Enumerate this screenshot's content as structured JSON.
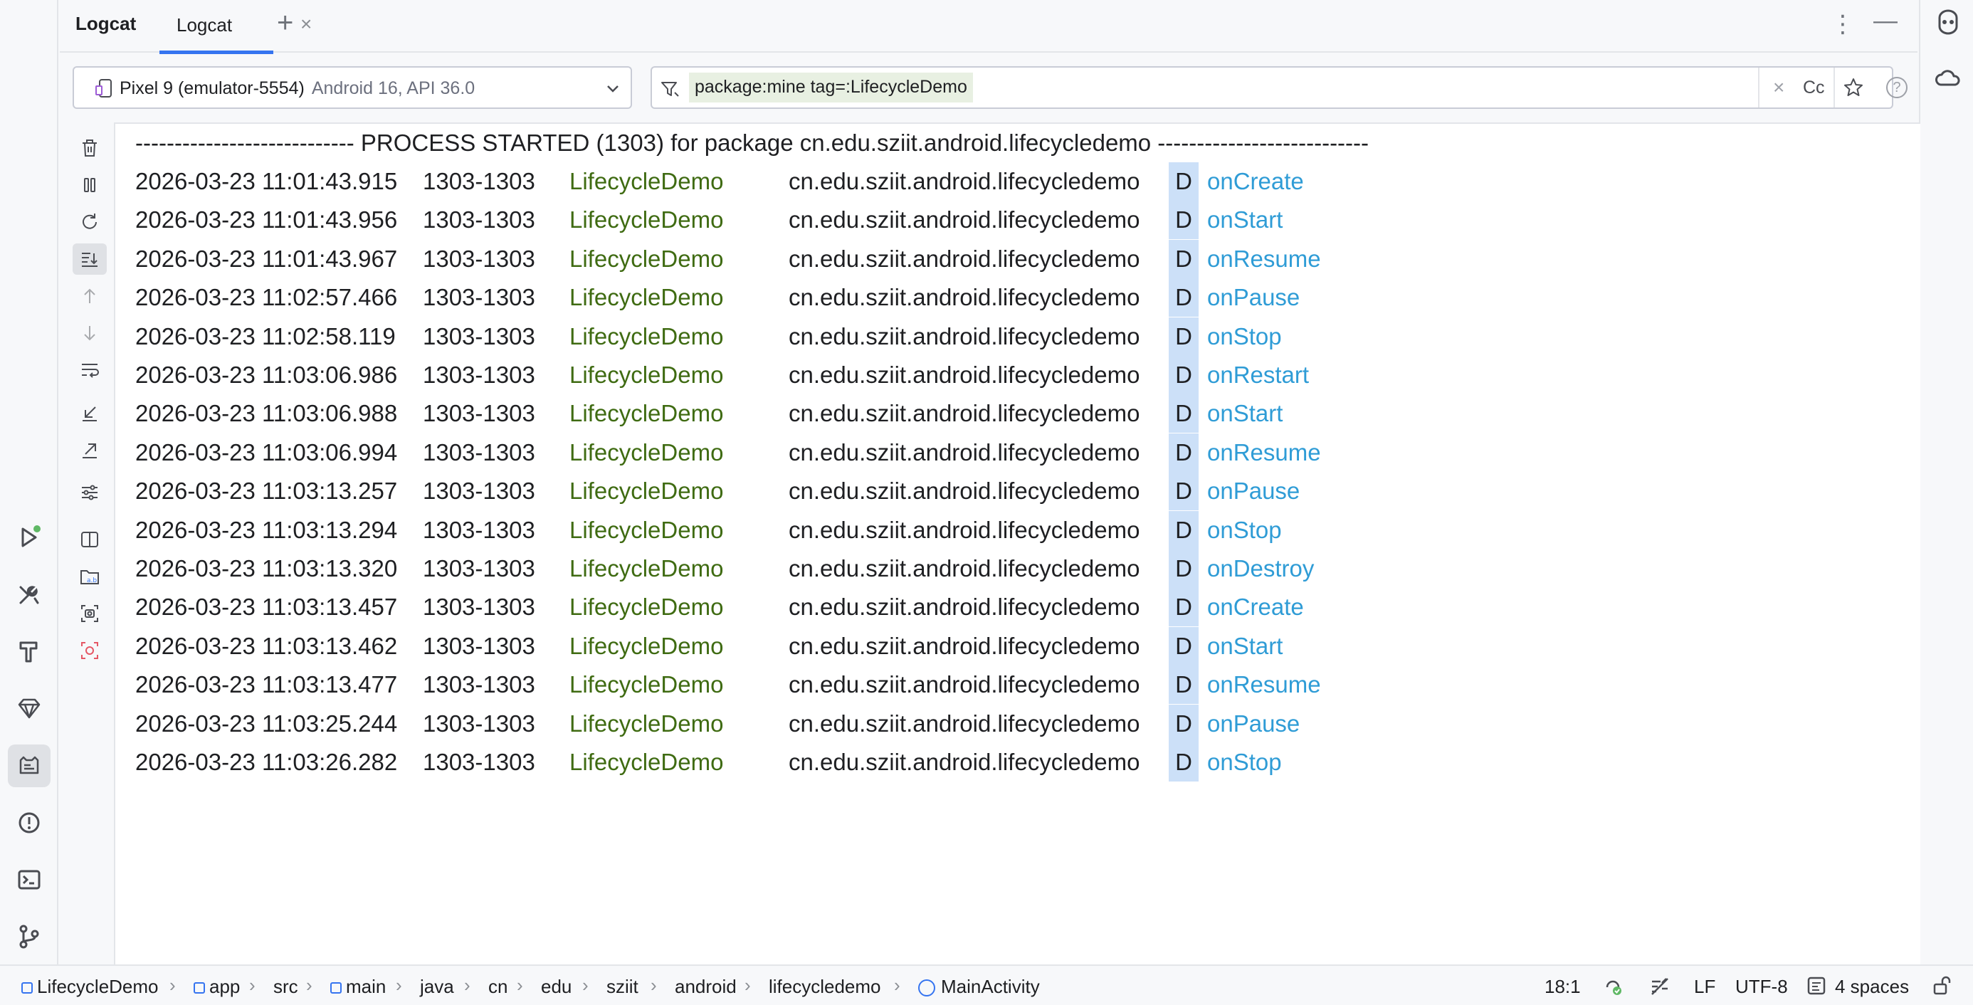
{
  "tool_window": {
    "title": "Logcat",
    "tabs": [
      {
        "label": "Logcat"
      }
    ],
    "add_tab_label": "+",
    "more_label": "⋮",
    "minimize_label": "—"
  },
  "device_selector": {
    "name": "Pixel 9 (emulator-5554)",
    "api": "Android 16, API 36.0"
  },
  "filter": {
    "query": "package:mine tag=:LifecycleDemo",
    "clear_label": "×",
    "match_case_label": "Cc",
    "help_label": "?"
  },
  "log": {
    "process_line": "---------------------------- PROCESS STARTED (1303) for package cn.edu.sziit.android.lifecycledemo ---------------------------",
    "entries": [
      {
        "datetime": "2026-03-23 11:01:43.915",
        "pid_tid": "1303-1303",
        "tag": "LifecycleDemo",
        "package": "cn.edu.sziit.android.lifecycledemo",
        "level": "D",
        "message": "onCreate"
      },
      {
        "datetime": "2026-03-23 11:01:43.956",
        "pid_tid": "1303-1303",
        "tag": "LifecycleDemo",
        "package": "cn.edu.sziit.android.lifecycledemo",
        "level": "D",
        "message": "onStart"
      },
      {
        "datetime": "2026-03-23 11:01:43.967",
        "pid_tid": "1303-1303",
        "tag": "LifecycleDemo",
        "package": "cn.edu.sziit.android.lifecycledemo",
        "level": "D",
        "message": "onResume"
      },
      {
        "datetime": "2026-03-23 11:02:57.466",
        "pid_tid": "1303-1303",
        "tag": "LifecycleDemo",
        "package": "cn.edu.sziit.android.lifecycledemo",
        "level": "D",
        "message": "onPause"
      },
      {
        "datetime": "2026-03-23 11:02:58.119",
        "pid_tid": "1303-1303",
        "tag": "LifecycleDemo",
        "package": "cn.edu.sziit.android.lifecycledemo",
        "level": "D",
        "message": "onStop"
      },
      {
        "datetime": "2026-03-23 11:03:06.986",
        "pid_tid": "1303-1303",
        "tag": "LifecycleDemo",
        "package": "cn.edu.sziit.android.lifecycledemo",
        "level": "D",
        "message": "onRestart"
      },
      {
        "datetime": "2026-03-23 11:03:06.988",
        "pid_tid": "1303-1303",
        "tag": "LifecycleDemo",
        "package": "cn.edu.sziit.android.lifecycledemo",
        "level": "D",
        "message": "onStart"
      },
      {
        "datetime": "2026-03-23 11:03:06.994",
        "pid_tid": "1303-1303",
        "tag": "LifecycleDemo",
        "package": "cn.edu.sziit.android.lifecycledemo",
        "level": "D",
        "message": "onResume"
      },
      {
        "datetime": "2026-03-23 11:03:13.257",
        "pid_tid": "1303-1303",
        "tag": "LifecycleDemo",
        "package": "cn.edu.sziit.android.lifecycledemo",
        "level": "D",
        "message": "onPause"
      },
      {
        "datetime": "2026-03-23 11:03:13.294",
        "pid_tid": "1303-1303",
        "tag": "LifecycleDemo",
        "package": "cn.edu.sziit.android.lifecycledemo",
        "level": "D",
        "message": "onStop"
      },
      {
        "datetime": "2026-03-23 11:03:13.320",
        "pid_tid": "1303-1303",
        "tag": "LifecycleDemo",
        "package": "cn.edu.sziit.android.lifecycledemo",
        "level": "D",
        "message": "onDestroy"
      },
      {
        "datetime": "2026-03-23 11:03:13.457",
        "pid_tid": "1303-1303",
        "tag": "LifecycleDemo",
        "package": "cn.edu.sziit.android.lifecycledemo",
        "level": "D",
        "message": "onCreate"
      },
      {
        "datetime": "2026-03-23 11:03:13.462",
        "pid_tid": "1303-1303",
        "tag": "LifecycleDemo",
        "package": "cn.edu.sziit.android.lifecycledemo",
        "level": "D",
        "message": "onStart"
      },
      {
        "datetime": "2026-03-23 11:03:13.477",
        "pid_tid": "1303-1303",
        "tag": "LifecycleDemo",
        "package": "cn.edu.sziit.android.lifecycledemo",
        "level": "D",
        "message": "onResume"
      },
      {
        "datetime": "2026-03-23 11:03:25.244",
        "pid_tid": "1303-1303",
        "tag": "LifecycleDemo",
        "package": "cn.edu.sziit.android.lifecycledemo",
        "level": "D",
        "message": "onPause"
      },
      {
        "datetime": "2026-03-23 11:03:26.282",
        "pid_tid": "1303-1303",
        "tag": "LifecycleDemo",
        "package": "cn.edu.sziit.android.lifecycledemo",
        "level": "D",
        "message": "onStop"
      }
    ]
  },
  "colors": {
    "tag": "#3f6b12",
    "message": "#2f9cd6",
    "level_bg": "#cce0f8",
    "accent": "#3574f0",
    "filter_highlight": "#e8f0e2"
  },
  "left_toolbar_icons": [
    "run-icon",
    "build-icon",
    "hammer-icon",
    "gem-icon",
    "logcat-icon",
    "problems-icon",
    "terminal-icon",
    "git-icon"
  ],
  "log_toolbar_icons": [
    "trash-icon",
    "pause-icon",
    "restart-icon",
    "scroll-to-end-icon",
    "up-icon",
    "down-icon",
    "soft-wrap-icon",
    "import-icon",
    "export-icon",
    "settings-icon",
    "split-icon",
    "folder-icon",
    "screenshot-icon",
    "record-icon"
  ],
  "breadcrumb": [
    {
      "label": "LifecycleDemo",
      "type": "module"
    },
    {
      "label": "app",
      "type": "module"
    },
    {
      "label": "src",
      "type": "folder"
    },
    {
      "label": "main",
      "type": "module"
    },
    {
      "label": "java",
      "type": "folder"
    },
    {
      "label": "cn",
      "type": "folder"
    },
    {
      "label": "edu",
      "type": "folder"
    },
    {
      "label": "sziit",
      "type": "folder"
    },
    {
      "label": "android",
      "type": "folder"
    },
    {
      "label": "lifecycledemo",
      "type": "folder"
    },
    {
      "label": "MainActivity",
      "type": "class"
    }
  ],
  "status": {
    "position": "18:1",
    "line_ending": "LF",
    "encoding": "UTF-8",
    "indent": "4 spaces"
  }
}
